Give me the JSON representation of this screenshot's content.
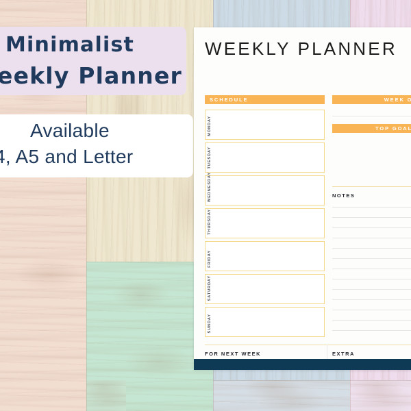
{
  "background": {
    "panels": [
      {
        "name": "peach-plank-left",
        "color": "#f2ddd1"
      },
      {
        "name": "cream-plank-top",
        "color": "#efe7cf"
      },
      {
        "name": "mint-plank-bottom",
        "color": "#c5e6d2"
      },
      {
        "name": "blue-plank-top",
        "color": "#ccdbe6"
      },
      {
        "name": "pink-plank-right",
        "color": "#efdcec"
      },
      {
        "name": "blue-plank-bottom",
        "color": "#d6dee5"
      },
      {
        "name": "lilac-plank-bottom-right",
        "color": "#efe2ef"
      }
    ]
  },
  "promo": {
    "lavender_card_color": "#ece0ef",
    "white_card_color": "#ffffff",
    "heading_color": "#1f3a5c",
    "heading_line_1": "Minimalist",
    "heading_line_2": "eekly Planner",
    "sub_line_1": "Available",
    "sub_line_2": "4, A5 and Letter"
  },
  "planner": {
    "title": "WEEKLY PLANNER",
    "accent_orange": "#f9b455",
    "border_yellow": "#f5d98a",
    "footer_navy": "#0e3a55",
    "paper_color": "#fdfdfb",
    "schedule_header": "SCHEDULE",
    "week_of_header": "WEEK OF",
    "top_goals_header": "TOP GOALS",
    "notes_header": "NOTES",
    "for_next_week_header": "FOR NEXT WEEK",
    "extra_header": "EXTRA",
    "days": [
      {
        "label": "MONDAY",
        "value": ""
      },
      {
        "label": "TUESDAY",
        "value": ""
      },
      {
        "label": "WEDNESDAY",
        "value": ""
      },
      {
        "label": "THURSDAY",
        "value": ""
      },
      {
        "label": "FRIDAY",
        "value": ""
      },
      {
        "label": "SATURDAY",
        "value": ""
      },
      {
        "label": "SUNDAY",
        "value": ""
      }
    ],
    "week_of_value": "",
    "top_goals_value": "",
    "notes_value": "",
    "notes_line_count": 13,
    "for_next_week_value": "",
    "extra_value": ""
  }
}
